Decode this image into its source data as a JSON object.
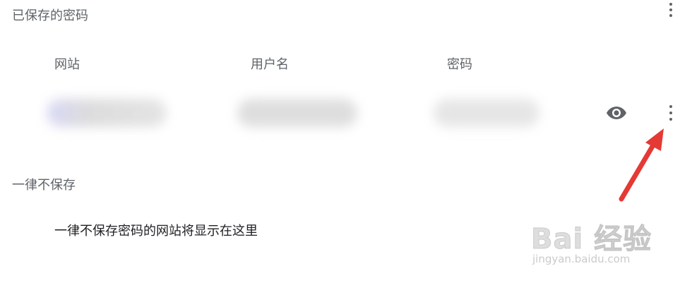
{
  "saved_passwords": {
    "title": "已保存的密码",
    "columns": {
      "website": "网站",
      "username": "用户名",
      "password": "密码"
    }
  },
  "never_saved": {
    "title": "一律不保存",
    "empty_message": "一律不保存密码的网站将显示在这里"
  },
  "icons": {
    "top_menu": "more-vert-icon",
    "show_password": "eye-icon",
    "row_menu": "more-vert-icon"
  },
  "annotation_color": "#e53935",
  "watermark": {
    "text": "Bai 经验",
    "url": "jingyan.baidu.com"
  }
}
